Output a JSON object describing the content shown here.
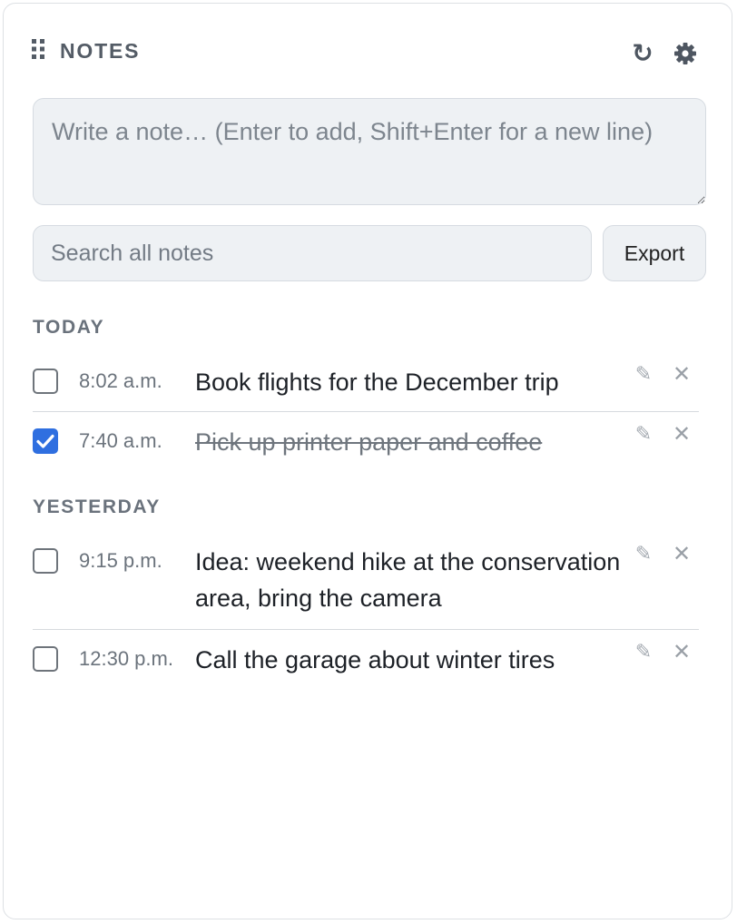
{
  "header": {
    "title": "NOTES",
    "drag_icon": "drag-handle-icon",
    "refresh_icon": "refresh-icon",
    "refresh_glyph": "↻",
    "settings_icon": "gear-icon"
  },
  "composer": {
    "placeholder": "Write a note… (Enter to add, Shift+Enter for a new line)",
    "value": ""
  },
  "search": {
    "placeholder": "Search all notes",
    "value": ""
  },
  "export_label": "Export",
  "colors": {
    "accent": "#2f6fe0",
    "section_label": "#6a727c",
    "field_background": "#eef1f4"
  },
  "sections": [
    {
      "label": "TODAY",
      "notes": [
        {
          "time": "8:02 a.m.",
          "text": "Book flights for the December trip",
          "done": false
        },
        {
          "time": "7:40 a.m.",
          "text": "Pick up printer paper and coffee",
          "done": true
        }
      ]
    },
    {
      "label": "YESTERDAY",
      "notes": [
        {
          "time": "9:15 p.m.",
          "text": "Idea: weekend hike at the conservation area, bring the camera",
          "done": false
        },
        {
          "time": "12:30 p.m.",
          "text": "Call the garage about winter tires",
          "done": false
        }
      ]
    }
  ],
  "row_actions": {
    "edit_glyph": "✎",
    "delete_glyph": "✕"
  }
}
